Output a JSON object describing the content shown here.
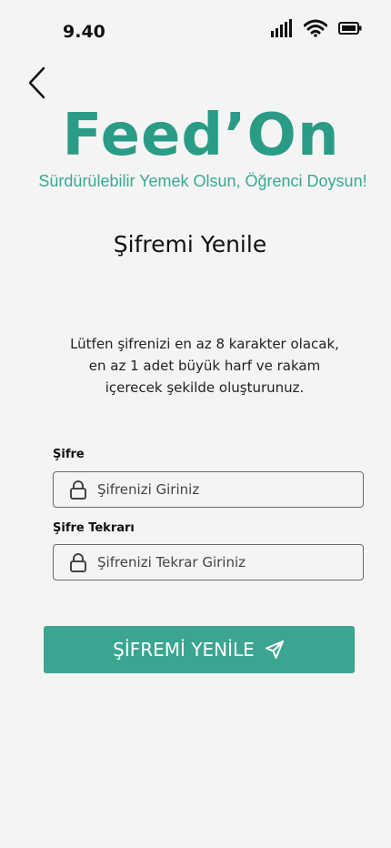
{
  "status_bar": {
    "time": "9.40",
    "icons": [
      "signal-icon",
      "wifi-icon",
      "battery-icon"
    ]
  },
  "header": {
    "back_icon": "chevron-left-icon",
    "brand": "Feed’On",
    "tagline": "Sürdürülebilir Yemek Olsun, Öğrenci Doysun!"
  },
  "page": {
    "title": "Şifremi Yenile",
    "instructions": [
      "Lütfen şifrenizi en az 8 karakter olacak,",
      "en az 1 adet büyük harf ve rakam",
      "içerecek şekilde oluşturunuz."
    ]
  },
  "form": {
    "password": {
      "label": "Şifre",
      "placeholder": "Şifrenizi Giriniz",
      "value": "",
      "icon": "lock-icon"
    },
    "password_repeat": {
      "label": "Şifre Tekrarı",
      "placeholder": "Şifrenizi Tekrar Giriniz",
      "value": "",
      "icon": "lock-icon"
    },
    "submit": {
      "label": "ŞİFREMİ YENİLE",
      "icon": "send-icon"
    }
  },
  "colors": {
    "brand": "#2a9c86",
    "tagline": "#3aa894",
    "button": "#3ba591",
    "background": "#f4f4f4"
  }
}
